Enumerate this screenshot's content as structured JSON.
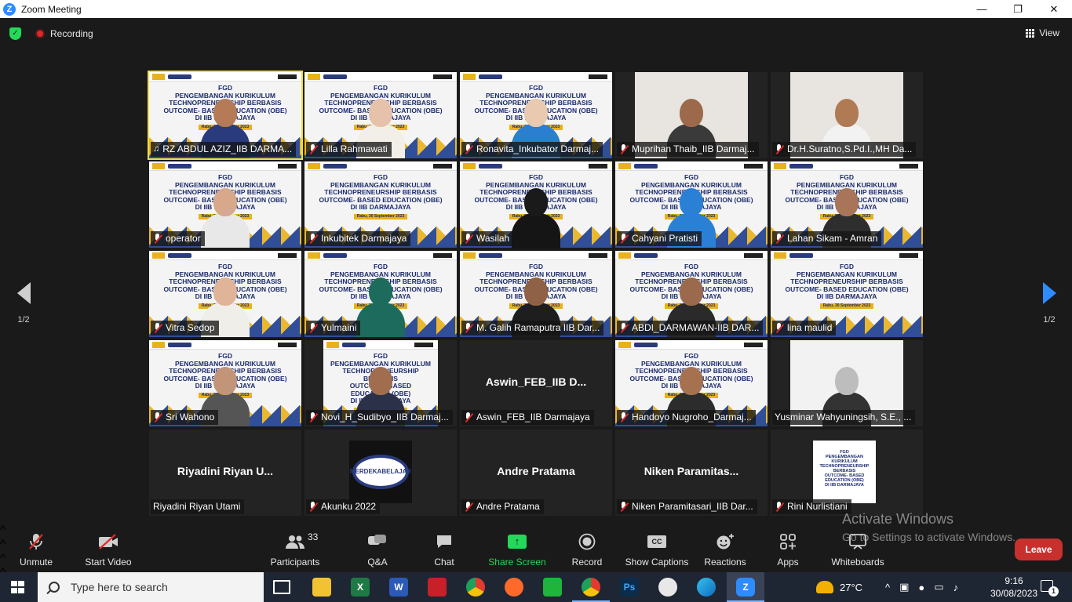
{
  "window": {
    "title": "Zoom Meeting"
  },
  "topbar": {
    "recording_label": "Recording",
    "view_label": "View"
  },
  "pager": {
    "left_label": "1/2",
    "right_label": "1/2"
  },
  "participants": [
    {
      "name": "RZ ABDUL AZIZ_IIB DARMA...",
      "kind": "slide",
      "muted": false,
      "active": true,
      "skin": "#b57a56",
      "cloth": "#2a3b7d"
    },
    {
      "name": "Lilla Rahmawati",
      "kind": "slide",
      "muted": true,
      "skin": "#e6c2aa",
      "cloth": "#f2efe9"
    },
    {
      "name": "Ronavita_Inkubator Darmaj...",
      "kind": "slide",
      "muted": true,
      "skin": "#e9c9b0",
      "cloth": "#2a7fd0"
    },
    {
      "name": "Muprihan Thaib_IIB Darmaj...",
      "kind": "photo",
      "muted": true,
      "skin": "#9c6a4a",
      "cloth": "#3a3a3a"
    },
    {
      "name": "Dr.H.Suratno,S.Pd.I.,MH Da...",
      "kind": "photo",
      "muted": true,
      "skin": "#b07a55",
      "cloth": "#f2f2f2"
    },
    {
      "name": "operator",
      "kind": "slide",
      "muted": true,
      "skin": "#d7a88a",
      "cloth": "#e8e8e8"
    },
    {
      "name": "Inkubitek Darmajaya",
      "kind": "slide",
      "muted": true,
      "skin": "",
      "cloth": ""
    },
    {
      "name": "Wasilah",
      "kind": "slide",
      "muted": true,
      "skin": "#1a1a1a",
      "cloth": "#151515"
    },
    {
      "name": "Cahyani Pratisti",
      "kind": "slide",
      "muted": true,
      "skin": "#2a80d5",
      "cloth": "#2a80d5"
    },
    {
      "name": "Lahan Sikam - Amran",
      "kind": "slide",
      "muted": true,
      "skin": "#a8755a",
      "cloth": "#2e2e2e"
    },
    {
      "name": "Vitra Sedop",
      "kind": "slide",
      "muted": true,
      "skin": "#e0b498",
      "cloth": "#f0eee9"
    },
    {
      "name": "Yulmaini",
      "kind": "slide",
      "muted": true,
      "skin": "#1d6b5c",
      "cloth": "#1d6b5c"
    },
    {
      "name": "M. Galih Ramaputra IIB Dar...",
      "kind": "slide",
      "muted": true,
      "skin": "#8f6146",
      "cloth": "#1e1e1e"
    },
    {
      "name": "ABDI_DARMAWAN-IIB DAR...",
      "kind": "slide",
      "muted": true,
      "skin": "#9b6a4d",
      "cloth": "#2a2a2a"
    },
    {
      "name": "lina maulid",
      "kind": "slide",
      "muted": true,
      "skin": "",
      "cloth": ""
    },
    {
      "name": "Sri Wahono",
      "kind": "slide",
      "muted": true,
      "skin": "#c39578",
      "cloth": "#555555"
    },
    {
      "name": "Novi_H_Sudibyo_IIB Darmaj...",
      "kind": "slide-narrow",
      "muted": true,
      "skin": "#a06e4f",
      "cloth": "#2a3148"
    },
    {
      "name": "Aswin_FEB_IIB Darmajaya",
      "kind": "name",
      "display": "Aswin_FEB_IIB D...",
      "muted": true
    },
    {
      "name": "Handoyo Nugroho_Darmaj...",
      "kind": "slide",
      "muted": true,
      "skin": "#a5714f",
      "cloth": "#2c2c2c"
    },
    {
      "name": "Yusminar Wahyuningsih, S.E., ...",
      "kind": "photo-bw",
      "muted": false,
      "skin": "#bdbdbd",
      "cloth": "#333333"
    },
    {
      "name": "Riyadini Riyan Utami",
      "kind": "name",
      "display": "Riyadini Riyan U...",
      "muted": false
    },
    {
      "name": "Akunku 2022",
      "kind": "avatar",
      "muted": true
    },
    {
      "name": "Andre Pratama",
      "kind": "name",
      "display": "Andre Pratama",
      "muted": true
    },
    {
      "name": "Niken Paramitasari_IIB Dar...",
      "kind": "name",
      "display": "Niken  Paramitas...",
      "muted": true
    },
    {
      "name": "Rini Nurlistiani",
      "kind": "poster",
      "muted": true
    }
  ],
  "slide": {
    "line1": "FGD",
    "line2": "PENGEMBANGAN KURIKULUM",
    "line3": "TECHNOPRENEURSHIP BERBASIS",
    "line4": "OUTCOME- BASED EDUCATION (OBE)",
    "line5": "DI IIB DARMAJAYA",
    "date": "Rabu, 30 September 2023"
  },
  "avatar_text": {
    "a": "MERDEKA",
    "b": "BELAJAR"
  },
  "toolbar": {
    "unmute": "Unmute",
    "start_video": "Start Video",
    "participants": "Participants",
    "participants_count": "33",
    "qa": "Q&A",
    "chat": "Chat",
    "share": "Share Screen",
    "record": "Record",
    "captions": "Show Captions",
    "captions_icon": "CC",
    "reactions": "Reactions",
    "apps": "Apps",
    "whiteboards": "Whiteboards",
    "leave": "Leave"
  },
  "watermark": {
    "line1": "Activate Windows",
    "line2": "Go to Settings to activate Windows."
  },
  "taskbar": {
    "search_placeholder": "Type here to search",
    "temperature": "27°C",
    "time": "9:16",
    "date": "30/08/2023",
    "notification_count": "1"
  },
  "colors": {
    "zoom_blue": "#2d8cff",
    "share_green": "#23d959",
    "leave_red": "#c8302e",
    "active_speaker": "#f0e03a"
  }
}
